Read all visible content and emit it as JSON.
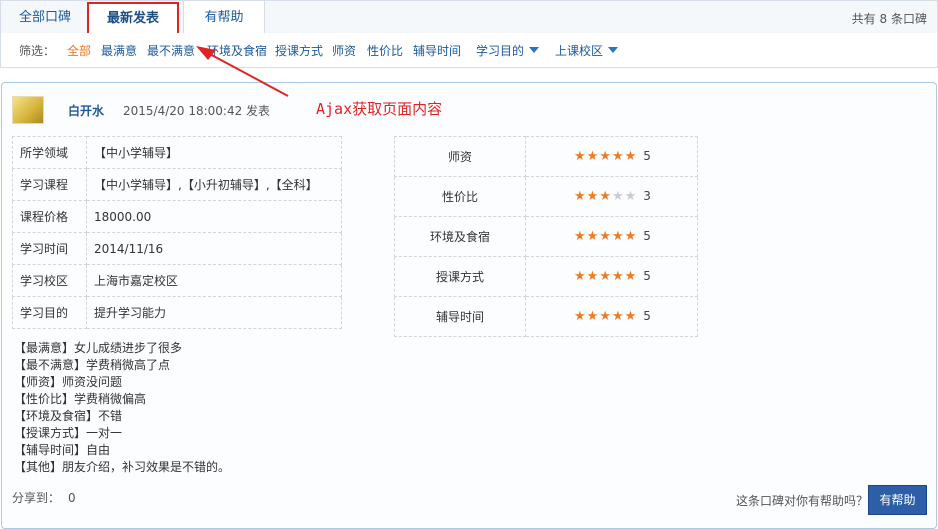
{
  "tabs": [
    {
      "label": "全部口碑"
    },
    {
      "label": "最新发表"
    },
    {
      "label": "有帮助"
    }
  ],
  "total": {
    "prefix": "共有",
    "count": "8",
    "suffix": "条口碑"
  },
  "filters": {
    "label": "筛选：",
    "items": [
      "全部",
      "最满意",
      "最不满意",
      "环境及食宿",
      "授课方式",
      "师资",
      "性价比",
      "辅导时间"
    ],
    "dropdowns": [
      "学习目的",
      "上课校区"
    ]
  },
  "annotation": {
    "text": "Ajax获取页面内容",
    "color": "#e02424"
  },
  "review": {
    "user": "白开水",
    "time": "2015/4/20 18:00:42 发表",
    "info": [
      {
        "key": "所学领域",
        "value": "【中小学辅导】"
      },
      {
        "key": "学习课程",
        "value": "【中小学辅导】,【小升初辅导】,【全科】"
      },
      {
        "key": "课程价格",
        "value": "18000.00"
      },
      {
        "key": "学习时间",
        "value": "2014/11/16"
      },
      {
        "key": "学习校区",
        "value": "上海市嘉定校区"
      },
      {
        "key": "学习目的",
        "value": "提升学习能力"
      }
    ],
    "ratings": [
      {
        "key": "师资",
        "stars": 5,
        "score": "5"
      },
      {
        "key": "性价比",
        "stars": 3,
        "score": "3"
      },
      {
        "key": "环境及食宿",
        "stars": 5,
        "score": "5"
      },
      {
        "key": "授课方式",
        "stars": 5,
        "score": "5"
      },
      {
        "key": "辅导时间",
        "stars": 5,
        "score": "5"
      }
    ],
    "comments": [
      "【最满意】女儿成绩进步了很多",
      "【最不满意】学费稍微高了点",
      "【师资】师资没问题",
      "【性价比】学费稍微偏高",
      "【环境及食宿】不错",
      "【授课方式】一对一",
      "【辅导时间】自由",
      "【其他】朋友介绍，补习效果是不错的。"
    ],
    "share_label": "分享到：",
    "share_count": "0",
    "helpful_question": "这条口碑对你有帮助吗？",
    "helpful_button": "有帮助"
  },
  "colors": {
    "accent": "#1b5a9a",
    "active_filter": "#e8781e",
    "star_on": "#ee7b22",
    "star_off": "#c8ccd3",
    "button": "#2d5fa8"
  }
}
